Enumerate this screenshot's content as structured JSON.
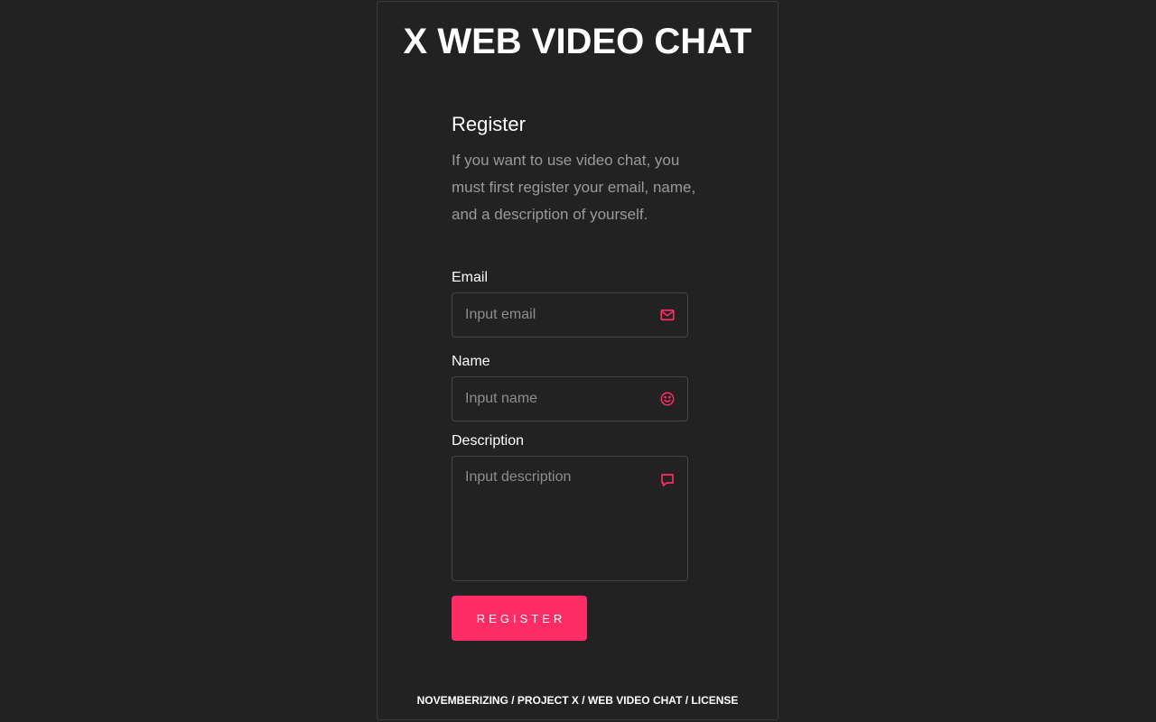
{
  "app": {
    "title": "X WEB VIDEO CHAT"
  },
  "form": {
    "title": "Register",
    "description": "If you want to use video chat, you must first register your email, name, and a description of yourself.",
    "email": {
      "label": "Email",
      "placeholder": "Input email",
      "value": "",
      "icon": "mail-icon"
    },
    "name": {
      "label": "Name",
      "placeholder": "Input name",
      "value": "",
      "icon": "smile-icon"
    },
    "description_field": {
      "label": "Description",
      "placeholder": "Input description",
      "value": "",
      "icon": "message-icon"
    },
    "submit_label": "REGISTER"
  },
  "footer": {
    "links": [
      "NOVEMBERIZING",
      "PROJECT X",
      "WEB VIDEO CHAT",
      "LICENSE"
    ],
    "separator": " / "
  },
  "colors": {
    "background": "#222222",
    "accent": "#ff2d66",
    "text": "#ffffff",
    "muted": "#9a9a9a",
    "border": "#474747"
  }
}
